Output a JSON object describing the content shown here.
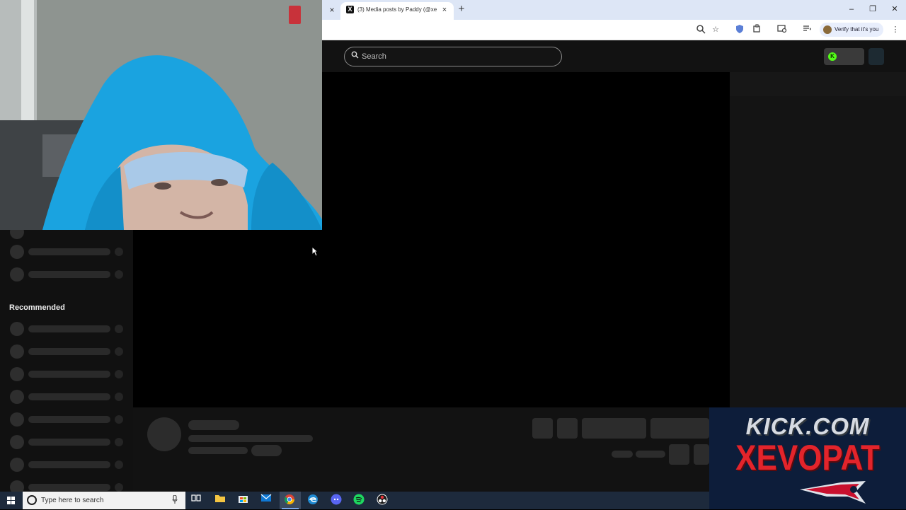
{
  "browser": {
    "prev_tab_close": "×",
    "active_tab": {
      "favicon": "X",
      "title": "(3) Media posts by Paddy (@xe",
      "close": "×"
    },
    "new_tab": "+",
    "window_controls": {
      "minimize": "–",
      "restore": "❐",
      "close": "✕"
    },
    "toolbar_icons": [
      "zoom-icon",
      "bookmark-star-icon",
      "shield-extension-icon",
      "extensions-puzzle-icon",
      "cast-search-icon",
      "media-queue-icon",
      "menu-kebab-icon"
    ],
    "verify_chip_label": "Verify that it's you"
  },
  "kick": {
    "search": {
      "placeholder": "Search",
      "icon": "search-icon"
    },
    "live_dot_label": "K",
    "sidebar": {
      "recommended_heading": "Recommended"
    }
  },
  "overlay": {
    "line1": "KICK.COM",
    "line2": "XEVOPAT"
  },
  "taskbar": {
    "search_placeholder": "Type here to search",
    "apps": [
      "task-view-icon",
      "file-explorer-icon",
      "store-icon",
      "mail-icon",
      "chrome-icon",
      "edge-icon",
      "discord-icon",
      "spotify-icon",
      "obs-icon"
    ]
  },
  "colors": {
    "kick_green": "#53fc18",
    "overlay_red": "#e3242b",
    "overlay_navy": "#0d1d3a",
    "taskbar": "#1d2a3c"
  }
}
